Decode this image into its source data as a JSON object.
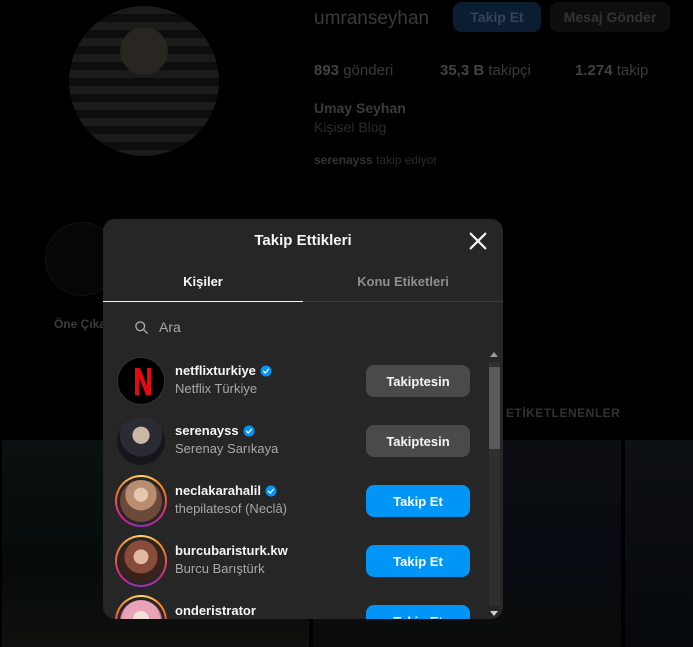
{
  "profile": {
    "username": "umranseyhan",
    "follow_label": "Takip Et",
    "message_label": "Mesaj Gönder",
    "posts_count": "893",
    "posts_label": "gönderi",
    "followers_count": "35,3 B",
    "followers_label": "takipçi",
    "following_count": "1.274",
    "following_label": "takip",
    "full_name": "Umay Seyhan",
    "category": "Kişisel Blog",
    "followed_by_user": "serenayss",
    "followed_by_text": "takip ediyor",
    "highlight_label": "Öne Çıka",
    "tagged_tab": "ETİKETLENENLER"
  },
  "modal": {
    "title": "Takip Ettikleri",
    "tabs": [
      {
        "label": "Kişiler",
        "active": true
      },
      {
        "label": "Konu Etiketleri",
        "active": false
      }
    ],
    "search_placeholder": "Ara",
    "users": [
      {
        "username": "netflixturkiye",
        "name": "Netflix Türkiye",
        "verified": true,
        "button": "Takiptesin",
        "following": true
      },
      {
        "username": "serenayss",
        "name": "Serenay Sarıkaya",
        "verified": true,
        "button": "Takiptesin",
        "following": true
      },
      {
        "username": "neclakarahalil",
        "name": "thepilatesof (Neclâ)",
        "verified": true,
        "button": "Takip Et",
        "following": false
      },
      {
        "username": "burcubaristurk.kw",
        "name": "Burcu Barıştürk",
        "verified": false,
        "button": "Takip Et",
        "following": false
      },
      {
        "username": "onderistrator",
        "name": "",
        "verified": false,
        "button": "Takip Et",
        "following": false
      }
    ]
  },
  "colors": {
    "accent": "#0095f6",
    "modal_bg": "#262626",
    "verified": "#0095f6",
    "netflix_red": "#e50914"
  }
}
